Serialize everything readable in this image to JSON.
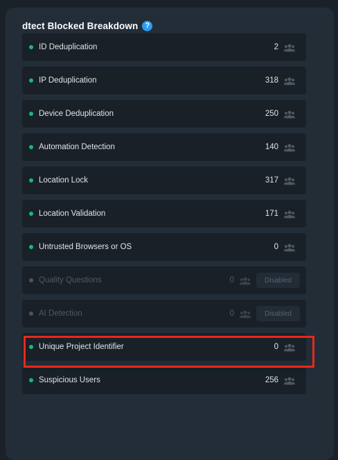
{
  "header": {
    "title": "dtect Blocked Breakdown",
    "help_glyph": "?"
  },
  "rows": [
    {
      "label": "ID Deduplication",
      "value": "2",
      "disabled": false
    },
    {
      "label": "IP Deduplication",
      "value": "318",
      "disabled": false
    },
    {
      "label": "Device Deduplication",
      "value": "250",
      "disabled": false
    },
    {
      "label": "Automation Detection",
      "value": "140",
      "disabled": false
    },
    {
      "label": "Location Lock",
      "value": "317",
      "disabled": false
    },
    {
      "label": "Location Validation",
      "value": "171",
      "disabled": false
    },
    {
      "label": "Untrusted Browsers or OS",
      "value": "0",
      "disabled": false
    },
    {
      "label": "Quality Questions",
      "value": "0",
      "disabled": true,
      "badge": "Disabled"
    },
    {
      "label": "AI Detection",
      "value": "0",
      "disabled": true,
      "badge": "Disabled"
    },
    {
      "label": "Unique Project Identifier",
      "value": "0",
      "disabled": false
    },
    {
      "label": "Suspicious Users",
      "value": "256",
      "disabled": false
    }
  ],
  "colors": {
    "active_dot": "#17b978",
    "inactive_dot": "#4b5560",
    "highlight": "#e8281d",
    "help": "#2f9bf0"
  },
  "icons": {
    "help": "question-circle-icon",
    "users": "users-icon"
  }
}
